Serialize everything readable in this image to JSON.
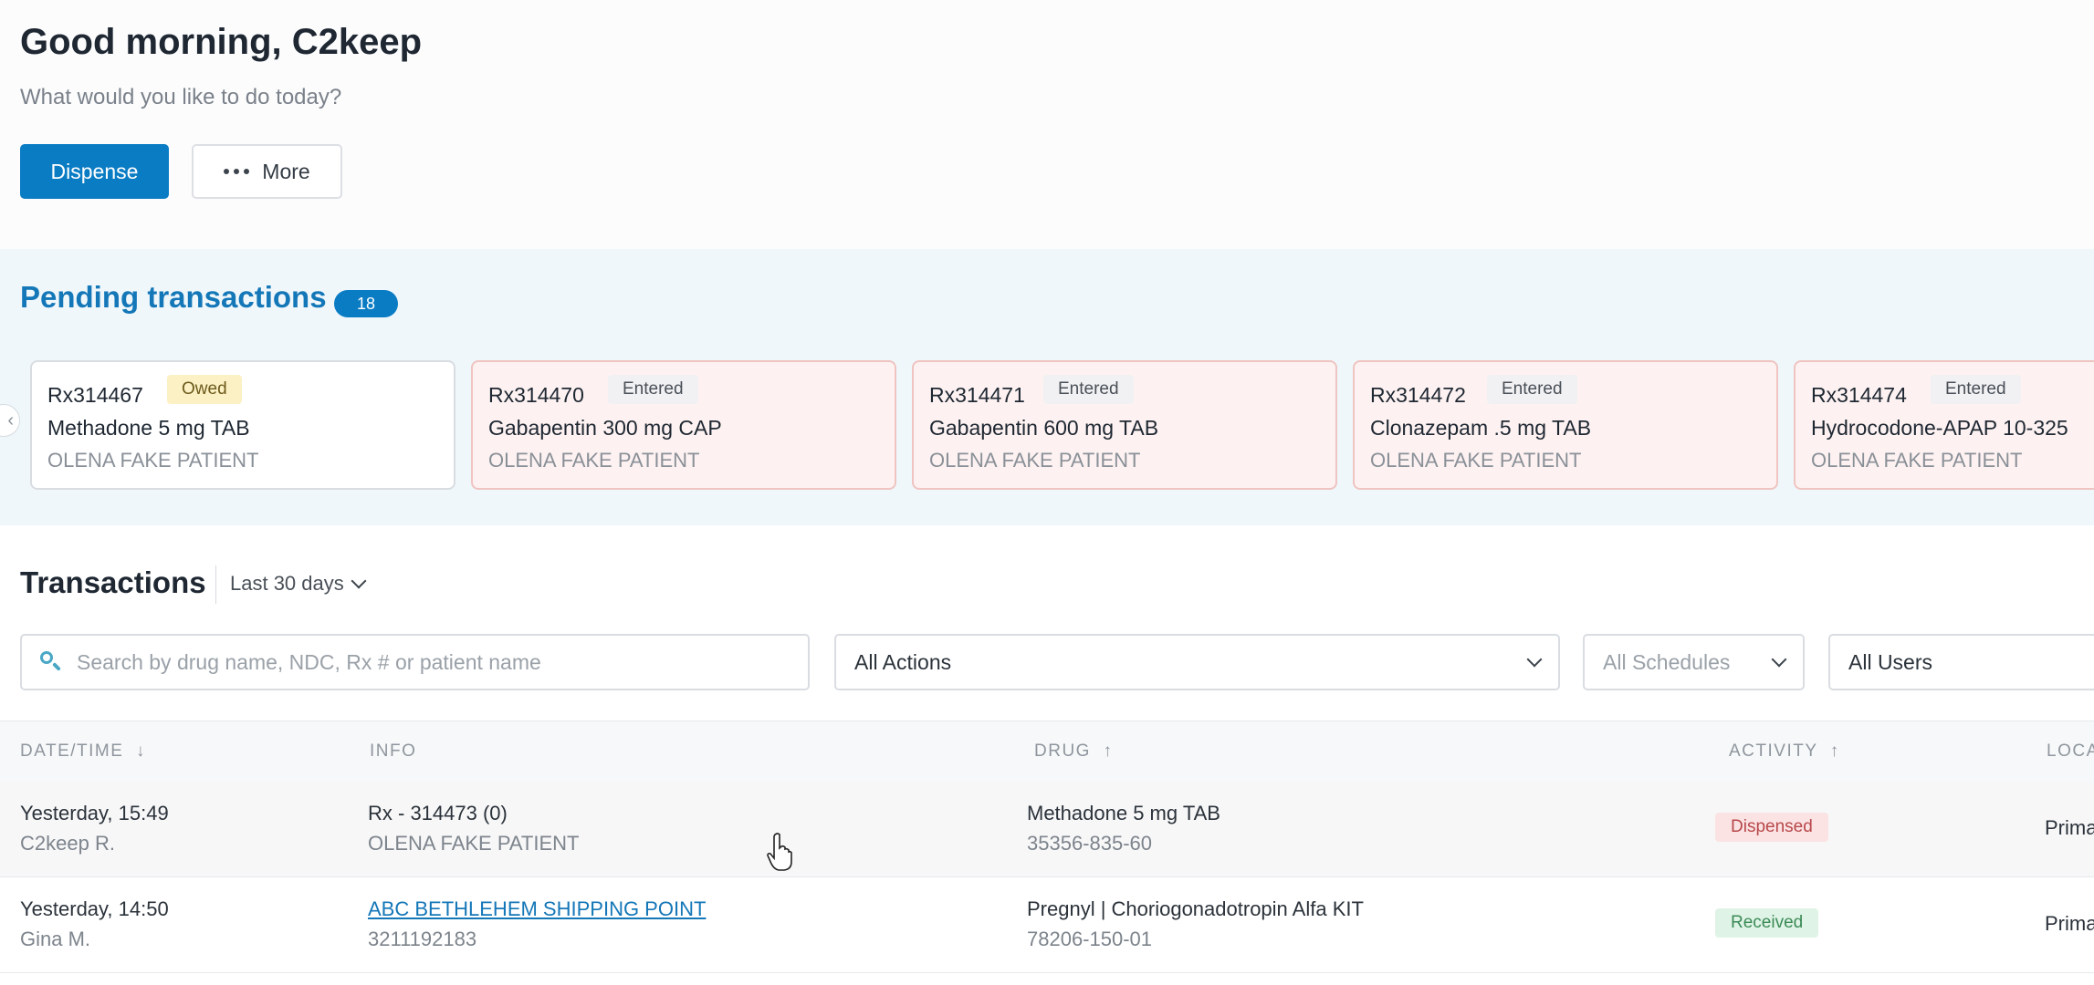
{
  "header": {
    "greeting": "Good morning, C2keep",
    "subtitle": "What would you like to do today?",
    "dispense_label": "Dispense",
    "more_label": "More"
  },
  "pending": {
    "title": "Pending transactions",
    "count": "18",
    "cards": [
      {
        "rx": "Rx314467",
        "status": "Owed",
        "drug": "Methadone 5 mg TAB",
        "patient": "OLENA FAKE PATIENT"
      },
      {
        "rx": "Rx314470",
        "status": "Entered",
        "drug": "Gabapentin 300 mg CAP",
        "patient": "OLENA FAKE PATIENT"
      },
      {
        "rx": "Rx314471",
        "status": "Entered",
        "drug": "Gabapentin 600 mg TAB",
        "patient": "OLENA FAKE PATIENT"
      },
      {
        "rx": "Rx314472",
        "status": "Entered",
        "drug": "Clonazepam .5 mg TAB",
        "patient": "OLENA FAKE PATIENT"
      },
      {
        "rx": "Rx314474",
        "status": "Entered",
        "drug": "Hydrocodone-APAP 10-325",
        "patient": "OLENA FAKE PATIENT"
      }
    ]
  },
  "transactions": {
    "title": "Transactions",
    "range": "Last 30 days",
    "search_placeholder": "Search by drug name, NDC, Rx # or patient name",
    "filters": {
      "actions": "All Actions",
      "schedules": "All Schedules",
      "users": "All Users"
    },
    "columns": {
      "datetime": "DATE/TIME",
      "info": "INFO",
      "drug": "DRUG",
      "activity": "ACTIVITY",
      "location": "LOCA"
    },
    "rows": [
      {
        "date": "Yesterday, 15:49",
        "user": "C2keep R.",
        "info": "Rx - 314473 (0)",
        "info_sub": "OLENA FAKE PATIENT",
        "drug": "Methadone 5 mg TAB",
        "ndc": "35356-835-60",
        "activity": "Dispensed",
        "location": "Prima"
      },
      {
        "date": "Yesterday, 14:50",
        "user": "Gina M.",
        "info": "ABC BETHLEHEM SHIPPING POINT",
        "info_sub": "3211192183",
        "drug": "Pregnyl | Choriogonadotropin Alfa KIT",
        "ndc": "78206-150-01",
        "activity": "Received",
        "location": "Prima"
      }
    ]
  }
}
